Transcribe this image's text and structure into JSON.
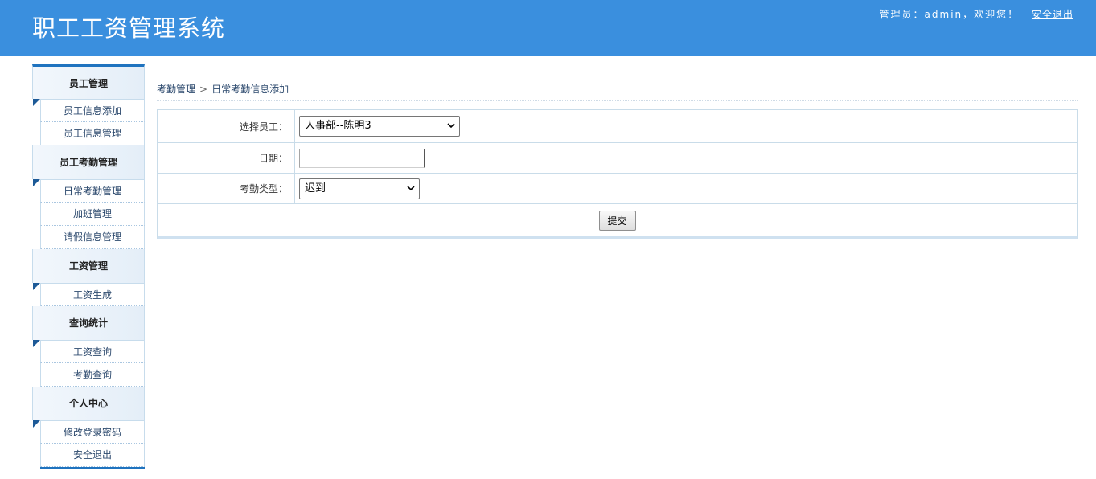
{
  "header": {
    "app_title": "职工工资管理系统",
    "greeting": "管理员：admin，欢迎您！",
    "logout_label": "安全退出"
  },
  "sidebar": {
    "groups": [
      {
        "title": "员工管理",
        "items": [
          {
            "label": "员工信息添加"
          },
          {
            "label": "员工信息管理"
          }
        ]
      },
      {
        "title": "员工考勤管理",
        "items": [
          {
            "label": "日常考勤管理"
          },
          {
            "label": "加班管理"
          },
          {
            "label": "请假信息管理"
          }
        ]
      },
      {
        "title": "工资管理",
        "items": [
          {
            "label": "工资生成"
          }
        ]
      },
      {
        "title": "查询统计",
        "items": [
          {
            "label": "工资查询"
          },
          {
            "label": "考勤查询"
          }
        ]
      },
      {
        "title": "个人中心",
        "items": [
          {
            "label": "修改登录密码"
          },
          {
            "label": "安全退出"
          }
        ]
      }
    ]
  },
  "breadcrumb": {
    "parent": "考勤管理",
    "separator": ">",
    "current": "日常考勤信息添加"
  },
  "form": {
    "employee_label": "选择员工：",
    "employee_value": "人事部--陈明3",
    "date_label": "日期：",
    "date_value": "",
    "type_label": "考勤类型：",
    "type_value": "迟到",
    "submit_label": "提交"
  },
  "colors": {
    "header_bg": "#3a8fde",
    "accent": "#1f73bf",
    "link_text": "#2d4a6e"
  },
  "icons": {
    "dropdown": "chevron-down-icon",
    "group_corner": "corner-triangle-icon"
  }
}
